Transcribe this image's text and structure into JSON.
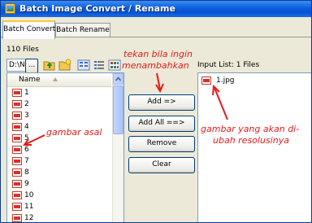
{
  "window": {
    "title": "Batch Image Convert / Rename"
  },
  "tabs": [
    {
      "label": "Batch Convert",
      "active": true
    },
    {
      "label": "Batch Rename",
      "active": false
    }
  ],
  "left_panel": {
    "files_count": "110 Files",
    "path_value": "D:\\N",
    "browse_label": "...",
    "column_header": "Name",
    "files": [
      "1",
      "2",
      "3",
      "4",
      "5",
      "6",
      "7",
      "8",
      "9",
      "10",
      "11",
      "12"
    ]
  },
  "buttons": {
    "add": "Add =>",
    "add_all": "Add All ==>",
    "remove": "Remove",
    "clear": "Clear"
  },
  "right_panel": {
    "label": "Input List: 1 Files",
    "files": [
      "1.jpg"
    ]
  },
  "annotations": {
    "add_note_line1": "tekan bila ingin",
    "add_note_line2": "menambahkan",
    "source_note": "gambar asal",
    "result_note_line1": "gambar yang akan di-",
    "result_note_line2": "ubah resolusinya"
  },
  "colors": {
    "annotation": "#e41b17",
    "title_bar": "#0a5ede"
  },
  "icons": [
    "folder-up-icon",
    "new-folder-icon",
    "list-view-icon",
    "details-view-icon",
    "thumbnail-view-icon",
    "jpg-file-icon"
  ]
}
